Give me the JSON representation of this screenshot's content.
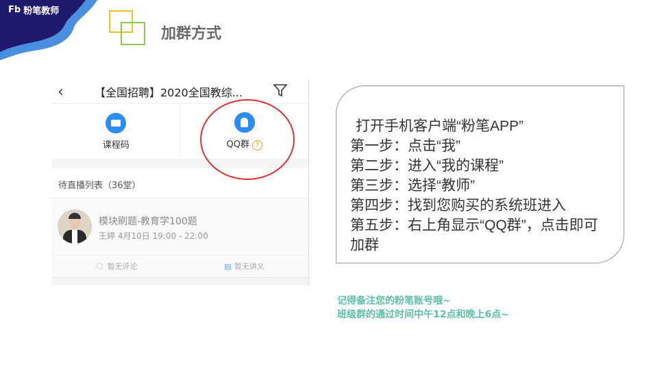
{
  "brand": {
    "logo_mark": "Fb",
    "name": "粉笔教师"
  },
  "slide_title": "加群方式",
  "phone": {
    "header_title": "【全国招聘】2020全国教综...",
    "tools": [
      {
        "label": "课程码",
        "icon": "tv-icon"
      },
      {
        "label": "QQ群",
        "icon": "qq-bell-icon",
        "help": "?"
      }
    ],
    "list_header": "待直播列表（36堂）",
    "lesson": {
      "title": "模块刷题-教育学100题",
      "meta": "王婷 4月10日 19:00 - 22:00",
      "comments": "暂无评论",
      "handout": "暂无讲义"
    },
    "highlight_color": "#e03030"
  },
  "steps": [
    "打开手机客户端“粉笔APP”",
    "第一步：点击“我”",
    "第二步：进入“我的课程”",
    "第三步：选择“教师”",
    "第四步：找到您购买的系统班进入",
    "第五步：右上角显示“QQ群”，点击即可加群"
  ],
  "notes": [
    "记得备注您的粉笔账号哦~",
    "班级群的通过时间中午12点和晚上6点~"
  ]
}
